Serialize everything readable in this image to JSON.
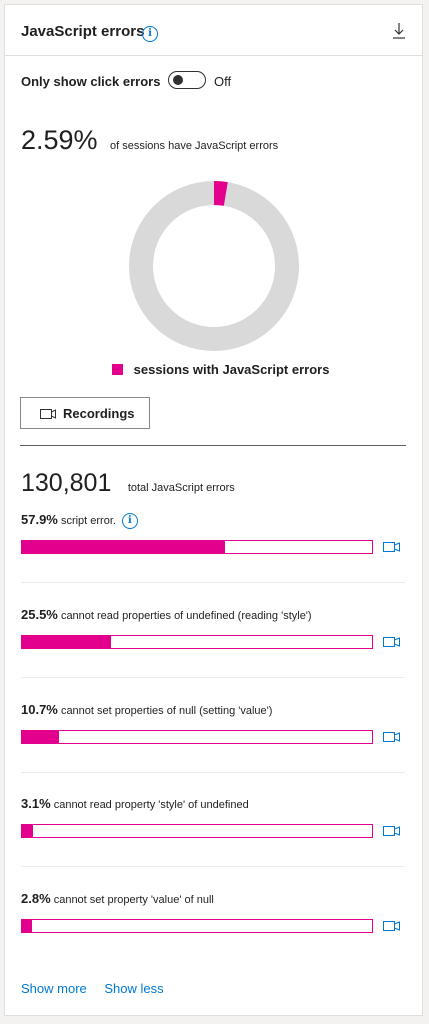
{
  "header": {
    "title": "JavaScript errors",
    "info_icon": "info-icon",
    "download_icon": "download-icon"
  },
  "toggle": {
    "label": "Only show click errors",
    "state": "Off",
    "on": false
  },
  "summary": {
    "percent": "2.59%",
    "text": "of sessions have JavaScript errors",
    "fraction": 0.0259
  },
  "legend": {
    "label": "sessions with JavaScript errors",
    "color": "#e3008c"
  },
  "recordings_button": {
    "label": "Recordings",
    "icon": "video-camera-icon"
  },
  "total": {
    "value": "130,801",
    "text": "total JavaScript errors"
  },
  "errors": [
    {
      "percent": "57.9%",
      "message": "script error.",
      "fraction": 0.579,
      "has_info": true
    },
    {
      "percent": "25.5%",
      "message": "cannot read properties of undefined (reading 'style')",
      "fraction": 0.255,
      "has_info": false
    },
    {
      "percent": "10.7%",
      "message": "cannot set properties of null (setting 'value')",
      "fraction": 0.107,
      "has_info": false
    },
    {
      "percent": "3.1%",
      "message": "cannot read property 'style' of undefined",
      "fraction": 0.031,
      "has_info": false
    },
    {
      "percent": "2.8%",
      "message": "cannot set property 'value' of null",
      "fraction": 0.028,
      "has_info": false
    }
  ],
  "links": {
    "show_more": "Show more",
    "show_less": "Show less"
  },
  "colors": {
    "accent": "#e3008c",
    "link": "#0078d4",
    "donut_track": "#d9d9d9"
  }
}
